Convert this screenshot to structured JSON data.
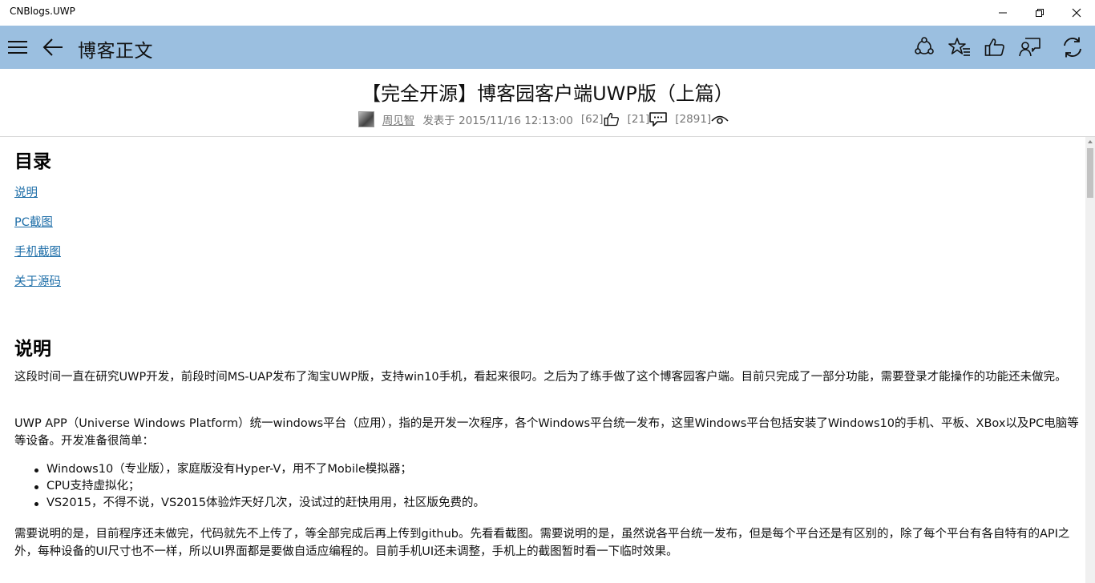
{
  "window": {
    "app_title": "CNBlogs.UWP"
  },
  "header": {
    "page_title": "博客正文",
    "actions": [
      "share-icon",
      "favorite-icon",
      "like-icon",
      "comments-icon",
      "refresh-icon"
    ]
  },
  "post": {
    "title": "【完全开源】博客园客户端UWP版（上篇）",
    "author": "周见智",
    "published": "发表于 2015/11/16 12:13:00",
    "likes": "[62]",
    "comments": "[21]",
    "views": "[2891]"
  },
  "toc": {
    "heading": "目录",
    "items": [
      "说明",
      "PC截图",
      "手机截图",
      "关于源码"
    ]
  },
  "section": {
    "heading": "说明",
    "p1": "这段时间一直在研究UWP开发，前段时间MS-UAP发布了淘宝UWP版，支持win10手机，看起来很叼。之后为了练手做了这个博客园客户端。目前只完成了一部分功能，需要登录才能操作的功能还未做完。",
    "p2": "UWP APP（Universe Windows Platform）统一windows平台（应用），指的是开发一次程序，各个Windows平台统一发布，这里Windows平台包括安装了Windows10的手机、平板、XBox以及PC电脑等等设备。开发准备很简单：",
    "bullets": [
      "Windows10（专业版），家庭版没有Hyper-V，用不了Mobile模拟器；",
      "CPU支持虚拟化；",
      "VS2015，不得不说，VS2015体验炸天好几次，没试过的赶快用用，社区版免费的。"
    ],
    "p3": "需要说明的是，目前程序还未做完，代码就先不上传了，等全部完成后再上传到github。先看看截图。需要说明的是，虽然说各平台统一发布，但是每个平台还是有区别的，除了每个平台有各自特有的API之外，每种设备的UI尺寸也不一样，所以UI界面都是要做自适应编程的。目前手机UI还未调整，手机上的截图暂时看一下临时效果。"
  },
  "colors": {
    "command_bar": "#9bbfe0",
    "link": "#1e6ea8"
  }
}
